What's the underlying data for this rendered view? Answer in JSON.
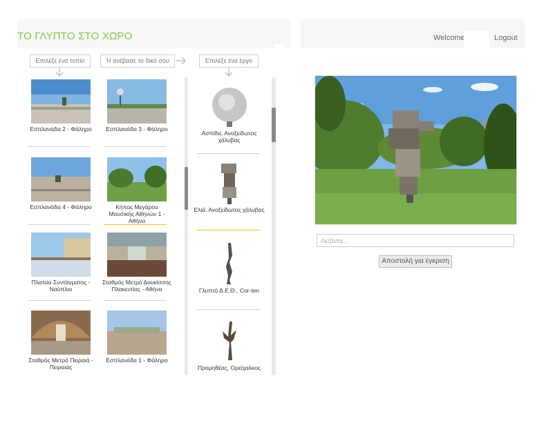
{
  "header": {
    "title": "ΤΟ ΓΛΥΠΤΟ ΣΤΟ ΧΩΡΟ",
    "welcome": "Welcome",
    "logout": "Logout",
    "accent_color": "#8cc63f"
  },
  "steps": {
    "choose_landscape": "Επιλέξε ένα τοπίο",
    "upload_own": "Ή ανέβασε το δικό σου",
    "choose_artwork": "Επιλέξε ένα έργο"
  },
  "landscapes": [
    "Εσπλανάδα 2 - Φάληρο",
    "Εσπλανάδα 3 - Φάληρο",
    "Εσπλανάδα 4 - Φάληρο",
    "Κήπος Μεγάρου Μουσικής Αθηνών 1 - Αθήνα",
    "Πλατεία Συντάγματος - Ναύπλιο",
    "Σταθμός Μετρό Δουκίσσης Πλακεντίας - Αθήνα",
    "Σταθμός Μετρό Πειραιά - Πειραιάς",
    "Εσπλανάδα 1 - Φάληρο"
  ],
  "artworks": [
    "Ασπίδα, Ανοξείδωτος χάλυβας",
    "Ελιά, Ανοξείδωτος χάλυβας",
    "Γλυπτό Δ.Ε.Θ., Cor-ten",
    "Προμηθέας, Ορείχαλκος"
  ],
  "selected": {
    "landscape": "Κήπος Μεγάρου Μουσικής Αθηνών 1 - Αθήνα",
    "artwork": "Ελιά, Ανοξείδωτος χάλυβας",
    "highlight_color": "#f2c21b"
  },
  "caption": {
    "placeholder": "Λεζάντα...",
    "value": ""
  },
  "submit_label": "Αποστολή για έγκριση"
}
